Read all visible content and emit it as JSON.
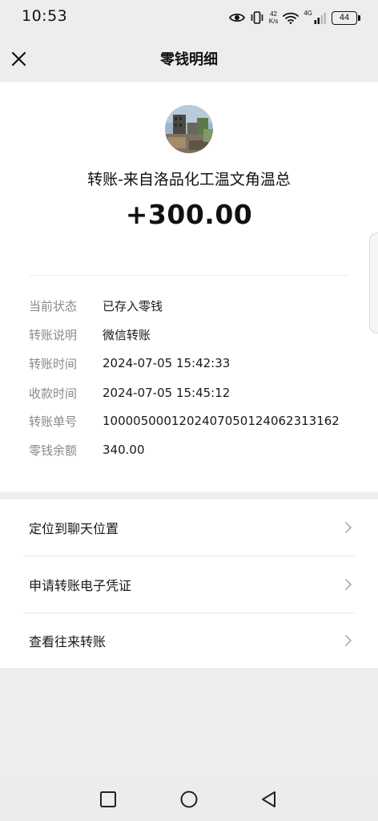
{
  "status_bar": {
    "time": "10:53",
    "net_speed_value": "42",
    "net_speed_unit": "K/s",
    "signal_label": "4G",
    "battery": "44",
    "icons": [
      "eye-icon",
      "vibrate-icon",
      "wifi-icon",
      "signal-icon",
      "battery-icon"
    ]
  },
  "nav": {
    "title": "零钱明细",
    "close_icon": "close-icon"
  },
  "transfer": {
    "title": "转账-来自洛品化工温文角温总",
    "amount": "+300.00"
  },
  "details": [
    {
      "label": "当前状态",
      "value": "已存入零钱"
    },
    {
      "label": "转账说明",
      "value": "微信转账"
    },
    {
      "label": "转账时间",
      "value": "2024-07-05 15:42:33"
    },
    {
      "label": "收款时间",
      "value": "2024-07-05 15:45:12"
    },
    {
      "label": "转账单号",
      "value": "1000050001202407050124062313162"
    },
    {
      "label": "零钱余额",
      "value": "340.00"
    }
  ],
  "actions": [
    {
      "label": "定位到聊天位置"
    },
    {
      "label": "申请转账电子凭证"
    },
    {
      "label": "查看往来转账"
    }
  ],
  "system_nav": {
    "icons": [
      "recent-apps-icon",
      "home-icon",
      "back-icon"
    ]
  },
  "colors": {
    "page_background": "#ededed",
    "card_background": "#ffffff",
    "label_gray": "#8a8a8a",
    "text_dark": "#191919"
  }
}
